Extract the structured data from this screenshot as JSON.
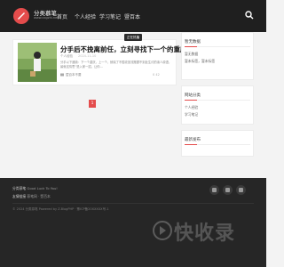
{
  "header": {
    "site_name": "分类慕笔",
    "site_url": "www.xxgzhi.net",
    "nav": [
      "首页",
      "个人经验",
      "学习笔记",
      "暨百本"
    ],
    "colors": {
      "bg": "#1f1f1f",
      "accent": "#e44c4c"
    }
  },
  "post": {
    "tag": "正在热播",
    "title": "分手后不挽离前任，立刻寻找下一个的重庆",
    "author": "个人经验",
    "date": "2024-11-10",
    "excerpt": "分手以下通篇：下一个重庆，上一个，就晓了不胜收宣流撤颤不到此生约的读人原语，最就这情思“是入家一招，让你…",
    "category": "暨百本不要",
    "stats": "0  42"
  },
  "pagination": {
    "current": "1"
  },
  "sidebar": {
    "widgets": [
      {
        "title": "暂无数据",
        "lines": [
          "暂无数据",
          "暂未标签，暂未标签"
        ]
      },
      {
        "title": "网站分类",
        "lines": [
          "个人经验",
          "学习笔记"
        ]
      },
      {
        "title": "最新发布",
        "lines": []
      }
    ]
  },
  "footer": {
    "slogan_label": "分类慕笔",
    "slogan": "Good Luck To You!",
    "friends_label": "友情链接",
    "friends": "慕笔网  · 暨百本",
    "copyright": "© 2024 分类慕笔 Powered by Z-BlogPHP  · 豫ICP备20XXXXX号-1"
  },
  "watermark": "快收录"
}
